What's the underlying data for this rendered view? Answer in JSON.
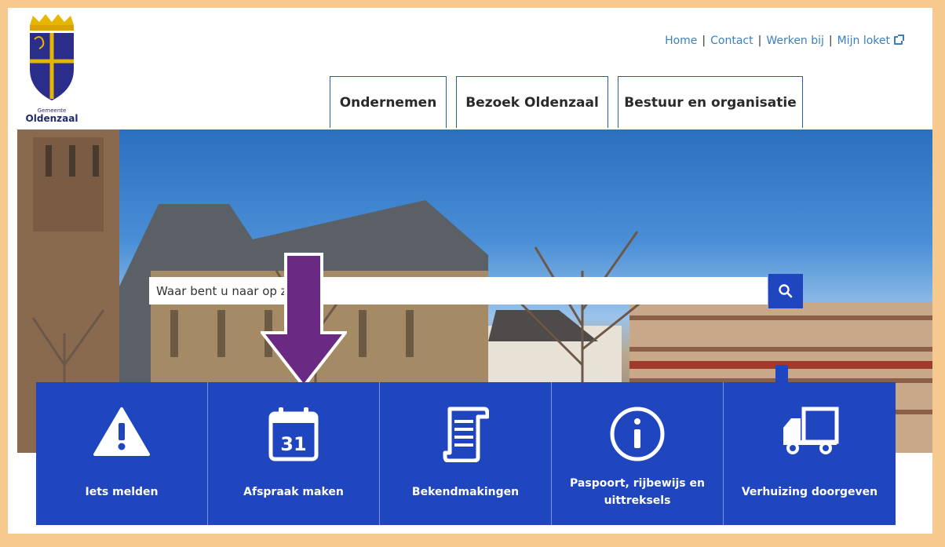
{
  "logo": {
    "municipality_label": "Gemeente",
    "name": "Oldenzaal"
  },
  "toplinks": [
    "Home",
    "Contact",
    "Werken bij",
    "Mijn loket"
  ],
  "nav": {
    "tabs": [
      "Ondernemen",
      "Bezoek Oldenzaal",
      "Bestuur en organisatie"
    ]
  },
  "search": {
    "placeholder": "Waar bent u naar op zoek?"
  },
  "tiles": [
    {
      "label": "Iets melden",
      "icon": "warning-icon"
    },
    {
      "label": "Afspraak maken",
      "icon": "calendar-icon",
      "calendar_day": "31"
    },
    {
      "label": "Bekendmakingen",
      "icon": "scroll-document-icon"
    },
    {
      "label": "Paspoort, rijbewijs en uittreksels",
      "icon": "info-icon"
    },
    {
      "label": "Verhuizing doorgeven",
      "icon": "moving-truck-icon"
    }
  ],
  "colors": {
    "tile_blue": "#1f45bf",
    "link_blue": "#3a7fc1",
    "arrow_purple": "#6a2a83",
    "frame_orange": "#f6c98f"
  }
}
